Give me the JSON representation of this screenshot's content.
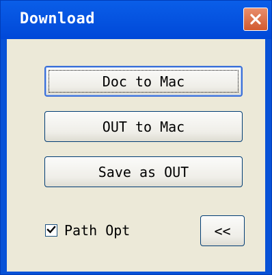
{
  "window": {
    "title": "Download"
  },
  "buttons": {
    "doc_to_mac": "Doc to Mac",
    "out_to_mac": "OUT to Mac",
    "save_as_out": "Save as OUT",
    "collapse": "<<"
  },
  "path_opt": {
    "label": "Path Opt",
    "checked": true
  },
  "colors": {
    "titlebar": "#0852d7",
    "client_bg": "#ece9d8",
    "close_button": "#d25a2f"
  },
  "icons": {
    "close": "close-icon",
    "check": "checkmark-icon"
  }
}
